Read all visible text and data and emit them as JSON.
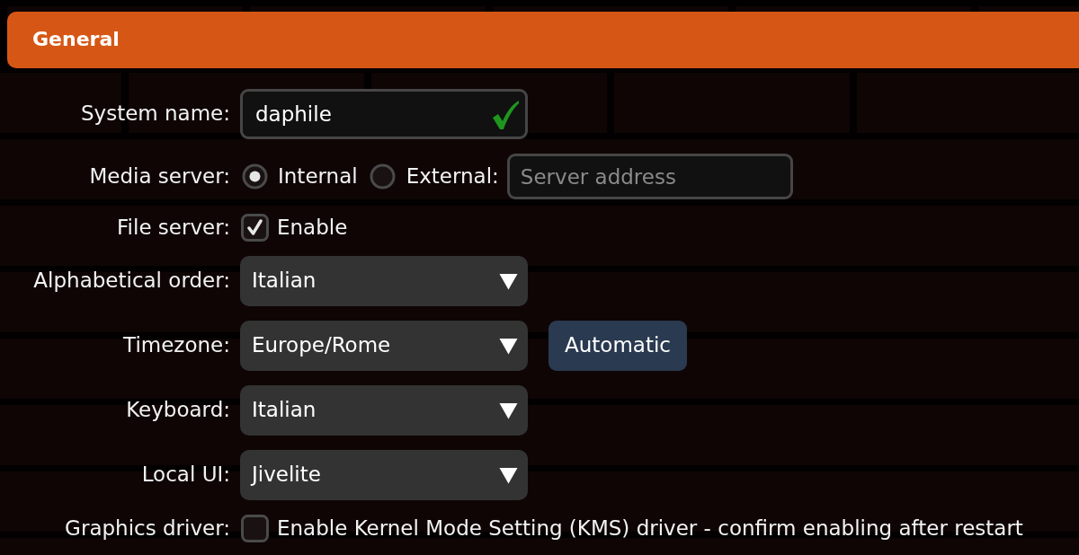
{
  "section": {
    "title": "General"
  },
  "fields": [
    {
      "kind": "text",
      "label": "System name:",
      "value": "daphile",
      "valid": true
    },
    {
      "kind": "radio",
      "label": "Media server:",
      "options": [
        {
          "label": "Internal",
          "selected": true
        },
        {
          "label": "External:",
          "selected": false
        }
      ],
      "input": {
        "placeholder": "Server address"
      }
    },
    {
      "kind": "checkbox",
      "label": "File server:",
      "option": {
        "label": "Enable",
        "checked": true
      }
    },
    {
      "kind": "select",
      "label": "Alphabetical order:",
      "value": "Italian"
    },
    {
      "kind": "select",
      "label": "Timezone:",
      "value": "Europe/Rome",
      "button": "Automatic"
    },
    {
      "kind": "select",
      "label": "Keyboard:",
      "value": "Italian"
    },
    {
      "kind": "select",
      "label": "Local UI:",
      "value": "Jivelite"
    },
    {
      "kind": "checkbox",
      "label": "Graphics driver:",
      "option": {
        "label": "Enable Kernel Mode Setting (KMS) driver - confirm enabling after restart",
        "checked": false
      }
    }
  ]
}
